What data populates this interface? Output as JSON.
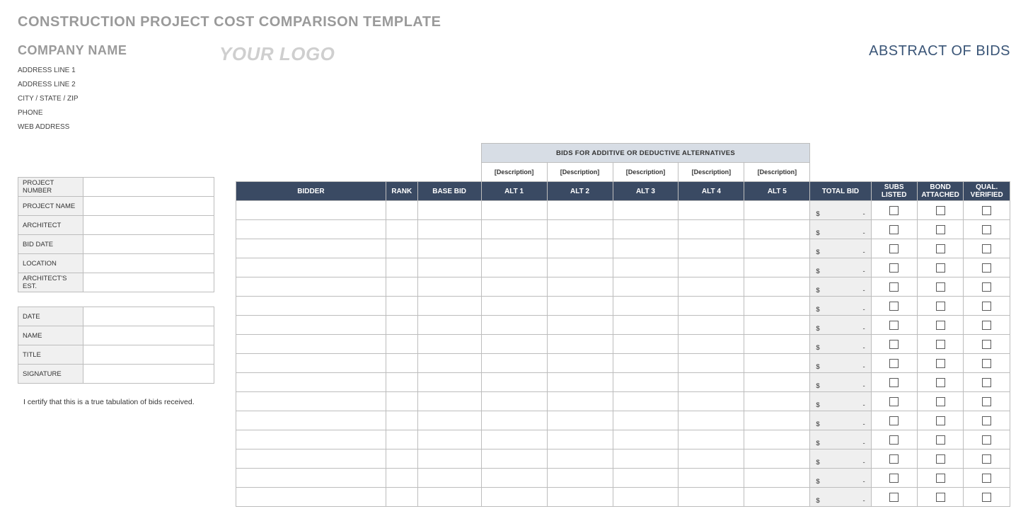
{
  "title": "CONSTRUCTION PROJECT COST COMPARISON TEMPLATE",
  "company": {
    "name": "COMPANY NAME",
    "addr1": "ADDRESS LINE 1",
    "addr2": "ADDRESS LINE 2",
    "citystate": "CITY / STATE / ZIP",
    "phone": "PHONE",
    "web": "WEB ADDRESS"
  },
  "logo": "YOUR LOGO",
  "abstract": "ABSTRACT OF BIDS",
  "project_fields": {
    "number": "PROJECT NUMBER",
    "name": "PROJECT NAME",
    "architect": "ARCHITECT",
    "biddate": "BID DATE",
    "location": "LOCATION",
    "archest": "ARCHITECT'S EST."
  },
  "sign_fields": {
    "date": "DATE",
    "name": "NAME",
    "title": "TITLE",
    "sig": "SIGNATURE"
  },
  "certify": "I certify that this is a true tabulation of bids received.",
  "headers": {
    "merged": "BIDS FOR ADDITIVE OR DEDUCTIVE ALTERNATIVES",
    "desc": "[Description]",
    "bidder": "BIDDER",
    "rank": "RANK",
    "base": "BASE BID",
    "alt1": "ALT 1",
    "alt2": "ALT 2",
    "alt3": "ALT 3",
    "alt4": "ALT 4",
    "alt5": "ALT 5",
    "total": "TOTAL BID",
    "subs": "SUBS LISTED",
    "bond": "BOND ATTACHED",
    "qual": "QUAL. VERIFIED"
  },
  "total_cell": {
    "dollar": "$",
    "dash": "-"
  },
  "row_count": 16
}
